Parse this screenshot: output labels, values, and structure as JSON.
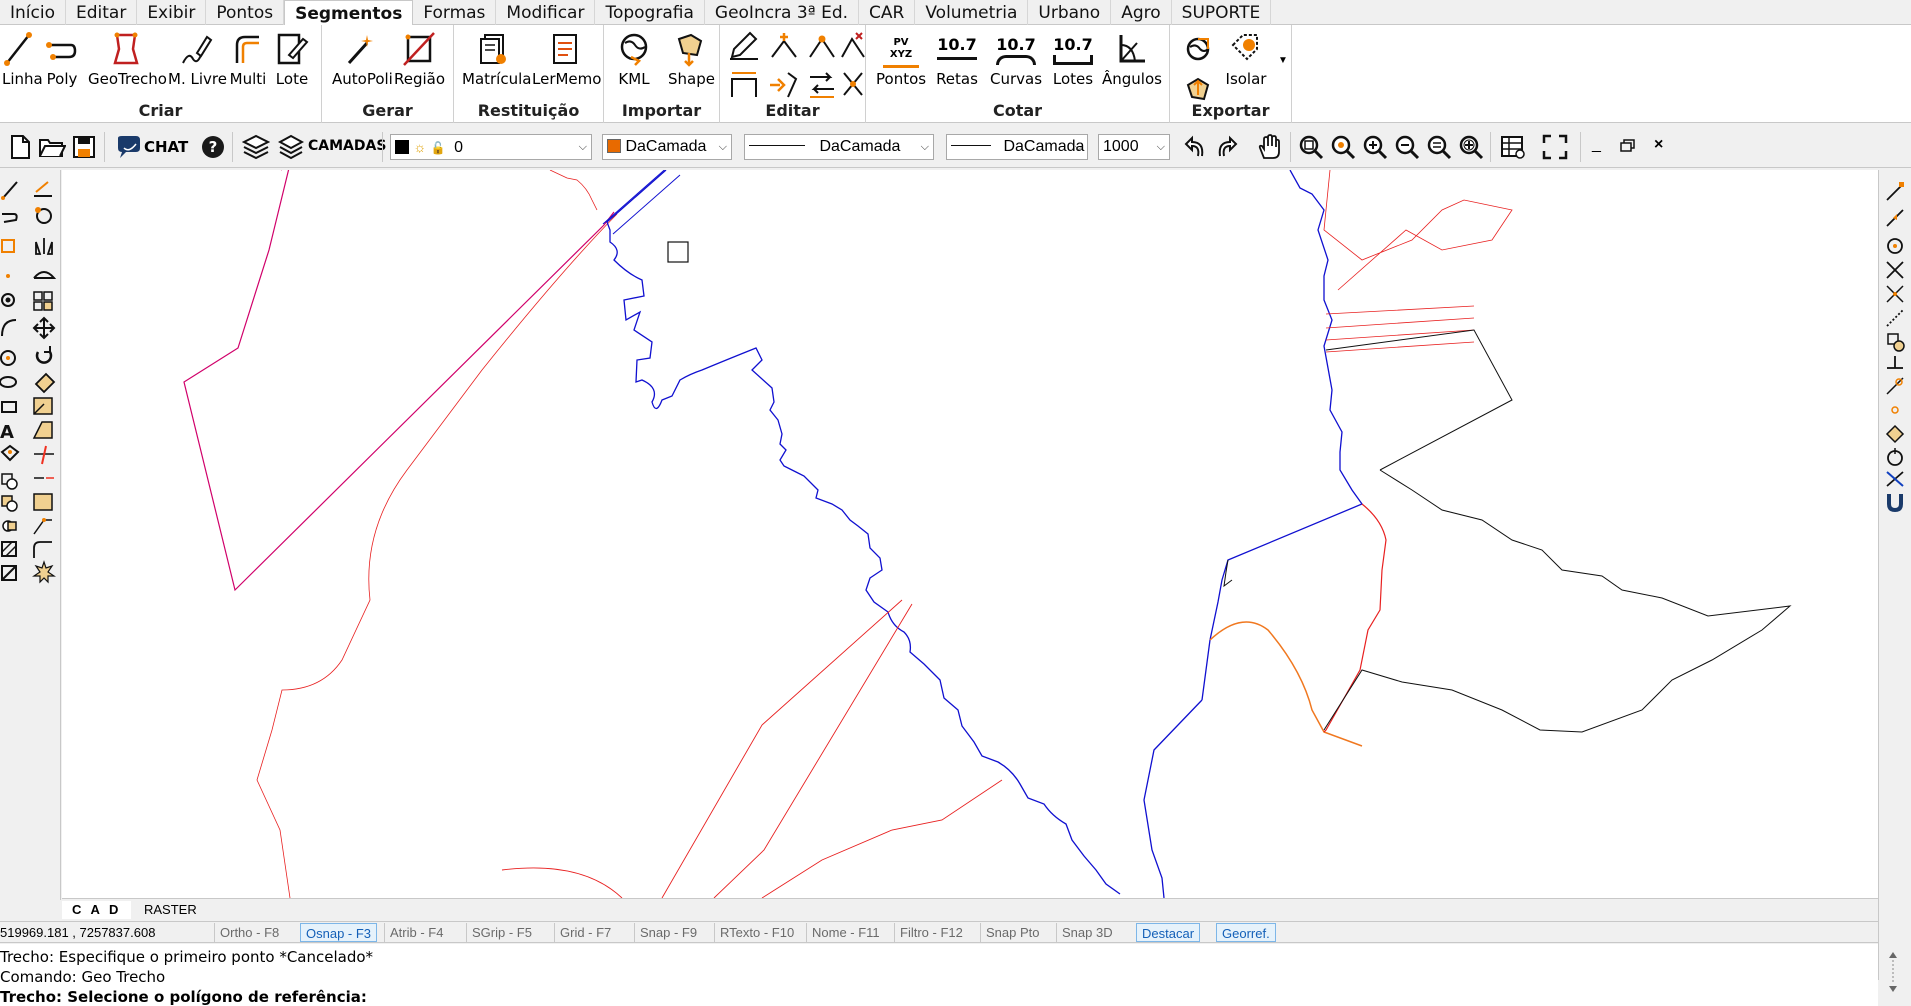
{
  "menu": {
    "tabs": [
      "Início",
      "Editar",
      "Exibir",
      "Pontos",
      "Segmentos",
      "Formas",
      "Modificar",
      "Topografia",
      "GeoIncra 3ª Ed.",
      "CAR",
      "Volumetria",
      "Urbano",
      "Agro",
      "SUPORTE"
    ],
    "active": "Segmentos"
  },
  "ribbon": {
    "groups": {
      "criar": "Criar",
      "gerar": "Gerar",
      "restituicao": "Restituição",
      "importar": "Importar",
      "editar": "Editar",
      "cotar": "Cotar",
      "exportar": "Exportar"
    },
    "buttons": {
      "linha": "Linha",
      "poly": "Poly",
      "geotrecho": "GeoTrecho",
      "mlivre": "M. Livre",
      "multi": "Multi",
      "lote": "Lote",
      "autopoli": "AutoPoli",
      "regiao": "Região",
      "matricula": "Matrícula",
      "lermemo": "LerMemo",
      "kml": "KML",
      "shape": "Shape",
      "pontos": "Pontos",
      "retas": "Retas",
      "curvas": "Curvas",
      "lotes": "Lotes",
      "angulos": "Ângulos",
      "isolar": "Isolar"
    },
    "icon_text": {
      "pontos_icon": "PV XYZ",
      "retas_icon": "10.7",
      "curvas_icon": "10.7",
      "lotes_icon": "10.7"
    }
  },
  "toolbar": {
    "chat": "CHAT",
    "camadas": "CAMADAS",
    "layer": "0",
    "color": "DaCamada",
    "linetype": "DaCamada",
    "lineweight": "DaCamada",
    "scale": "1000",
    "color_swatch": "#e86a00"
  },
  "viewtabs": [
    "C A D",
    "RASTER"
  ],
  "status": {
    "coords": "519969.181 , 7257837.608",
    "toggles": [
      {
        "label": "Ortho - F8",
        "on": false
      },
      {
        "label": "Osnap - F3",
        "on": true
      },
      {
        "label": "Atrib - F4",
        "on": false
      },
      {
        "label": "SGrip - F5",
        "on": false
      },
      {
        "label": "Grid - F7",
        "on": false
      },
      {
        "label": "Snap - F9",
        "on": false
      },
      {
        "label": "RTexto - F10",
        "on": false
      },
      {
        "label": "Nome - F11",
        "on": false
      },
      {
        "label": "Filtro - F12",
        "on": false
      },
      {
        "label": "Snap Pto",
        "on": false
      },
      {
        "label": "Snap 3D",
        "on": false
      },
      {
        "label": "Destacar",
        "on": true
      },
      {
        "label": "Georref.",
        "on": true
      }
    ]
  },
  "command": {
    "line1": "Trecho: Especifique o primeiro ponto *Cancelado*",
    "line2": "Comando: Geo Trecho",
    "line3": "Trecho: Selecione o polígono de referência:"
  },
  "colors": {
    "boundary_red": "#e82020",
    "boundary_blue": "#1010d0",
    "boundary_magenta": "#d0006a",
    "boundary_black": "#101010",
    "boundary_orange": "#f07820"
  }
}
